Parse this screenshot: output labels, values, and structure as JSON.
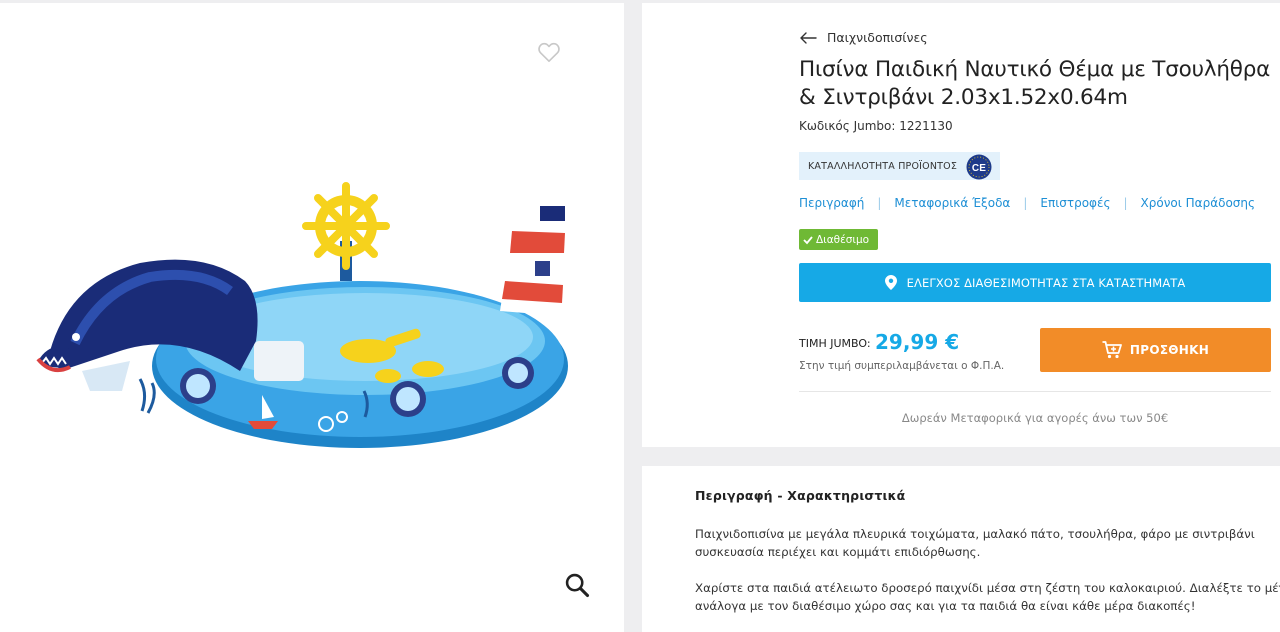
{
  "product_image": {
    "favorite_icon": "heart-outline-icon",
    "zoom_icon": "magnifier-icon"
  },
  "breadcrumb": {
    "back_icon": "arrow-left-icon",
    "label": "Παιχνιδοπισίνες"
  },
  "product": {
    "title": "Πισίνα Παιδική Ναυτικό Θέμα με Τσουλήθρα & Σιντριβάνι 2.03x1.52x0.64m",
    "code": "Κωδικός Jumbo: 1221130",
    "suitability_label": "ΚΑΤΑΛΛΗΛΟΤΗΤΑ ΠΡΟΪΟΝΤΟΣ",
    "ce_mark": "CE",
    "availability": "Διαθέσιμο",
    "store_button": "ΕΛΕΓΧΟΣ ΔΙΑΘΕΣΙΜΟΤΗΤΑΣ ΣΤΑ ΚΑΤΑΣΤΗΜΑΤΑ",
    "price_label": "ΤΙΜΗ JUMBO:",
    "price": "29,99 €",
    "vat_note": "Στην τιμή συμπεριλαμβάνεται ο Φ.Π.Α.",
    "add_button": "ΠΡΟΣΘΗΚΗ",
    "free_shipping": "Δωρεάν Μεταφορικά για αγορές άνω των 50€"
  },
  "tabs": [
    {
      "label": "Περιγραφή"
    },
    {
      "label": "Μεταφορικά Έξοδα"
    },
    {
      "label": "Επιστροφές"
    },
    {
      "label": "Χρόνοι Παράδοσης"
    }
  ],
  "description": {
    "heading": "Περιγραφή - Χαρακτηριστικά",
    "p1_line1": "Παιχνιδοπισίνα με μεγάλα πλευρικά τοιχώματα, μαλακό πάτο, τσουλήθρα, φάρο με σιντριβάνι",
    "p1_line2": "συσκευασία περιέχει και κομμάτι επιδιόρθωσης.",
    "p2_line1": "Χαρίστε στα παιδιά ατέλειωτο δροσερό παιχνίδι μέσα στη ζέστη του καλοκαιριού. Διαλέξτε το μέγεθ",
    "p2_line2": "ανάλογα με τον διαθέσιμο χώρο σας και για τα παιδιά θα είναι κάθε μέρα διακοπές!"
  },
  "colors": {
    "accent_blue": "#16a9e6",
    "add_orange": "#f28c28",
    "available_green": "#6fb935"
  }
}
